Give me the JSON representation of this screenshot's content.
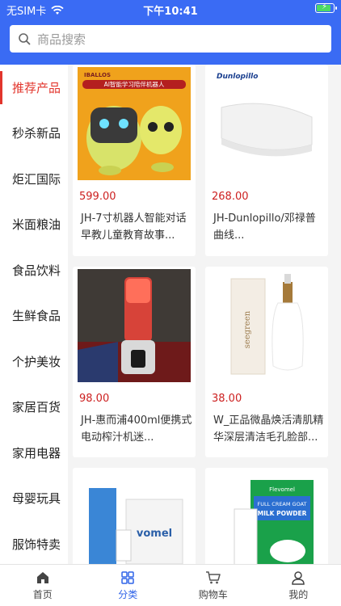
{
  "status": {
    "carrier": "无SIM卡",
    "time": "下午10:41"
  },
  "search": {
    "placeholder": "商品搜索",
    "icon": "search-icon"
  },
  "sidebar": {
    "items": [
      {
        "label": "推荐产品",
        "active": true
      },
      {
        "label": "秒杀新品"
      },
      {
        "label": "炬汇国际"
      },
      {
        "label": "米面粮油"
      },
      {
        "label": "食品饮料"
      },
      {
        "label": "生鲜食品"
      },
      {
        "label": "个护美妆"
      },
      {
        "label": "家居百货"
      },
      {
        "label": "家用电器"
      },
      {
        "label": "母婴玩具"
      },
      {
        "label": "服饰特卖"
      }
    ]
  },
  "products": [
    {
      "price": "599.00",
      "title": "JH-7寸机器人智能对话早教儿童教育故事...",
      "brand": "IBALLOS",
      "banner": "AI智能学习陪伴机器人"
    },
    {
      "price": "268.00",
      "title": "JH-Dunlopillo/邓禄普曲线...",
      "brand": "Dunlopillo"
    },
    {
      "price": "98.00",
      "title": "JH-惠而浦400ml便携式电动榨汁机迷..."
    },
    {
      "price": "38.00",
      "title": "W_正品微晶焕活清肌精华深层清洁毛孔脸部...",
      "brand": "seegreen"
    },
    {
      "price": "",
      "title": "",
      "brand": "vomel"
    },
    {
      "price": "",
      "title": "",
      "brand": "Flevomel",
      "label1": "FULL CREAM GOAT",
      "label2": "MILK POWDER"
    }
  ],
  "tabs": [
    {
      "label": "首页",
      "icon": "home-icon"
    },
    {
      "label": "分类",
      "icon": "category-icon",
      "active": true
    },
    {
      "label": "购物车",
      "icon": "cart-icon"
    },
    {
      "label": "我的",
      "icon": "user-icon"
    }
  ],
  "colors": {
    "header": "#3a6bf4",
    "active_side": "#e2352c",
    "price": "#cc1f1f",
    "tab_active": "#2f63e8"
  }
}
